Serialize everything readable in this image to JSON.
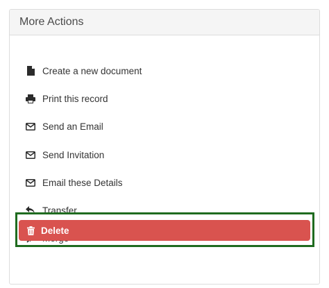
{
  "panel": {
    "title": "More Actions"
  },
  "actions": [
    {
      "label": "Create a new document",
      "icon": "file-icon"
    },
    {
      "label": "Print this record",
      "icon": "printer-icon"
    },
    {
      "label": "Send an Email",
      "icon": "envelope-icon"
    },
    {
      "label": "Send Invitation",
      "icon": "envelope-icon"
    },
    {
      "label": "Email these Details",
      "icon": "envelope-icon"
    },
    {
      "label": "Transfer",
      "icon": "reply-arrow-icon"
    },
    {
      "label": "Merge",
      "icon": "compress-arrows-icon"
    }
  ],
  "delete": {
    "label": "Delete",
    "icon": "trash-icon"
  },
  "colors": {
    "delete_background": "#d9534f",
    "highlight_border": "#1f6b1f",
    "header_background": "#f5f5f5"
  }
}
